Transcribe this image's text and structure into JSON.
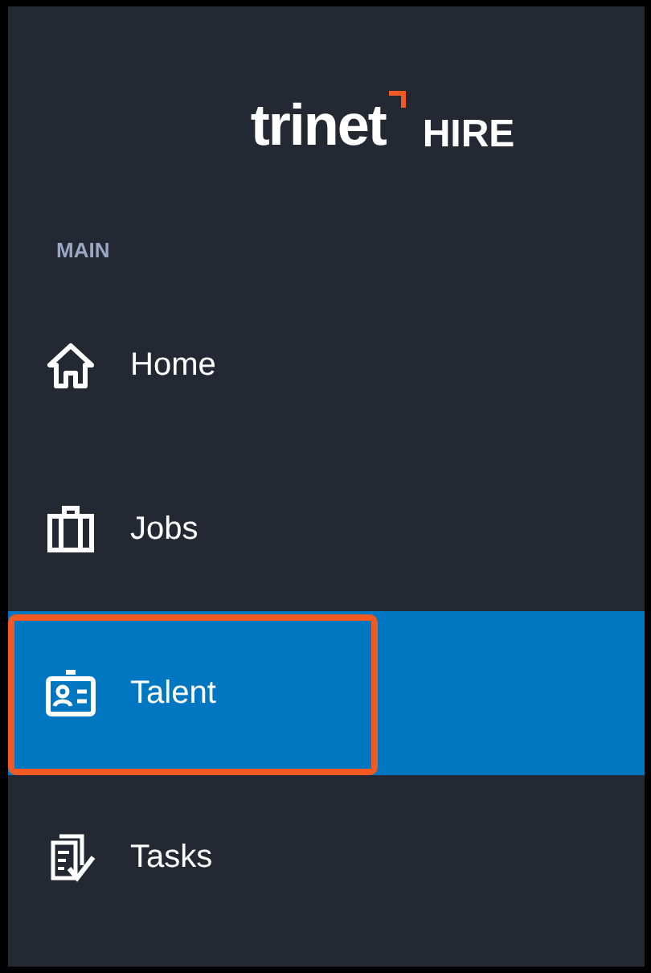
{
  "logo": {
    "brand": "trinet",
    "product": "HIRE"
  },
  "section_label": "MAIN",
  "nav_items": [
    {
      "label": "Home",
      "selected": false,
      "highlighted": false
    },
    {
      "label": "Jobs",
      "selected": false,
      "highlighted": false
    },
    {
      "label": "Talent",
      "selected": true,
      "highlighted": true
    },
    {
      "label": "Tasks",
      "selected": false,
      "highlighted": false
    }
  ]
}
